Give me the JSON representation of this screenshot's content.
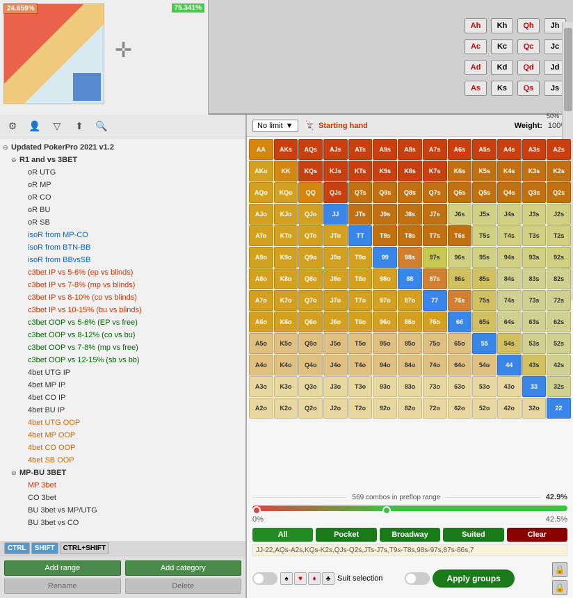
{
  "top": {
    "pct_red": "24.659%",
    "pct_green": "75.341%",
    "plus_icon": "✛",
    "cards": [
      [
        "Ah",
        "Kh",
        "Qh",
        "Jh"
      ],
      [
        "Ac",
        "Kc",
        "Qc",
        "Jc"
      ],
      [
        "Ad",
        "Kd",
        "Qd",
        "Jd"
      ],
      [
        "As",
        "Ks",
        "Qs",
        "Js"
      ]
    ],
    "card_colors": [
      [
        "red",
        "black",
        "red",
        "black"
      ],
      [
        "red",
        "black",
        "red",
        "black"
      ],
      [
        "red",
        "black",
        "red",
        "black"
      ],
      [
        "red",
        "black",
        "red",
        "black"
      ]
    ]
  },
  "toolbar": {
    "gear": "⚙",
    "person": "👤",
    "filter": "▽",
    "upload": "⬆",
    "search": "🔍"
  },
  "tree": {
    "root_label": "Updated PokerPro 2021 v1.2",
    "items": [
      {
        "id": "r1",
        "label": "R1 and vs 3BET",
        "indent": 1,
        "type": "parent",
        "color": "normal"
      },
      {
        "id": "utg",
        "label": "oR UTG",
        "indent": 2,
        "type": "leaf",
        "color": "normal"
      },
      {
        "id": "mp",
        "label": "oR MP",
        "indent": 2,
        "type": "leaf",
        "color": "normal"
      },
      {
        "id": "co",
        "label": "oR CO",
        "indent": 2,
        "type": "leaf",
        "color": "normal"
      },
      {
        "id": "bu",
        "label": "oR BU",
        "indent": 2,
        "type": "leaf",
        "color": "normal"
      },
      {
        "id": "sb",
        "label": "oR SB",
        "indent": 2,
        "type": "leaf",
        "color": "normal"
      },
      {
        "id": "isor_mp",
        "label": "isoR from MP-CO",
        "indent": 2,
        "type": "leaf",
        "color": "blue"
      },
      {
        "id": "isor_btn",
        "label": "isoR from BTN-BB",
        "indent": 2,
        "type": "leaf",
        "color": "blue"
      },
      {
        "id": "isor_bb",
        "label": "isoR from BBvsSB",
        "indent": 2,
        "type": "leaf",
        "color": "blue"
      },
      {
        "id": "c3bet56",
        "label": "c3bet IP vs 5-6% (ep vs blinds)",
        "indent": 2,
        "type": "leaf",
        "color": "red"
      },
      {
        "id": "c3bet78",
        "label": "c3bet IP vs 7-8% (mp vs blinds)",
        "indent": 2,
        "type": "leaf",
        "color": "red"
      },
      {
        "id": "c3bet810",
        "label": "c3bet IP vs 8-10% (co vs blinds)",
        "indent": 2,
        "type": "leaf",
        "color": "red"
      },
      {
        "id": "c3bet1015",
        "label": "c3bet IP vs 10-15% (bu vs blinds)",
        "indent": 2,
        "type": "leaf",
        "color": "red"
      },
      {
        "id": "c3bet_oop56",
        "label": "c3bet OOP vs 5-6% (EP vs free)",
        "indent": 2,
        "type": "leaf",
        "color": "green"
      },
      {
        "id": "c3bet_oop812",
        "label": "c3bet OOP vs 8-12% (co vs bu)",
        "indent": 2,
        "type": "leaf",
        "color": "green"
      },
      {
        "id": "c3bet_oop78",
        "label": "c3bet OOP vs 7-8% (mp vs free)",
        "indent": 2,
        "type": "leaf",
        "color": "green"
      },
      {
        "id": "c3bet_oop1215",
        "label": "c3bet OOP vs 12-15% (sb vs bb)",
        "indent": 2,
        "type": "leaf",
        "color": "green"
      },
      {
        "id": "4bet_utg",
        "label": "4bet UTG IP",
        "indent": 2,
        "type": "leaf",
        "color": "normal"
      },
      {
        "id": "4bet_mp",
        "label": "4bet MP IP",
        "indent": 2,
        "type": "leaf",
        "color": "normal"
      },
      {
        "id": "4bet_co",
        "label": "4bet CO IP",
        "indent": 2,
        "type": "leaf",
        "color": "normal"
      },
      {
        "id": "4bet_bu",
        "label": "4bet BU IP",
        "indent": 2,
        "type": "leaf",
        "color": "normal"
      },
      {
        "id": "4bet_utg_oop",
        "label": "4bet UTG OOP",
        "indent": 2,
        "type": "leaf",
        "color": "orange"
      },
      {
        "id": "4bet_mp_oop",
        "label": "4bet MP OOP",
        "indent": 2,
        "type": "leaf",
        "color": "orange"
      },
      {
        "id": "4bet_co_oop",
        "label": "4bet CO OOP",
        "indent": 2,
        "type": "leaf",
        "color": "orange"
      },
      {
        "id": "4bet_sb_oop",
        "label": "4bet SB OOP",
        "indent": 2,
        "type": "leaf",
        "color": "orange"
      },
      {
        "id": "mpbu",
        "label": "MP-BU 3BET",
        "indent": 1,
        "type": "parent",
        "color": "bold"
      },
      {
        "id": "mp3",
        "label": "MP 3bet",
        "indent": 2,
        "type": "leaf",
        "color": "red"
      },
      {
        "id": "co3",
        "label": "CO 3bet",
        "indent": 2,
        "type": "leaf",
        "color": "normal"
      },
      {
        "id": "bu3mp",
        "label": "BU 3bet vs MP/UTG",
        "indent": 2,
        "type": "leaf",
        "color": "normal"
      },
      {
        "id": "bu3co",
        "label": "BU 3bet vs CO",
        "indent": 2,
        "type": "leaf",
        "color": "normal"
      }
    ]
  },
  "range_header": {
    "dropdown_label": "No limit",
    "starting_hand_label": "Starting hand",
    "weight_label": "Weight:",
    "weight_value": "100%"
  },
  "hand_grid": {
    "cells": [
      [
        "AA",
        "AKs",
        "AQs",
        "AJs",
        "ATs",
        "A9s",
        "A8s",
        "A7s",
        "A6s",
        "A5s",
        "A4s",
        "A3s",
        "A2s"
      ],
      [
        "AKo",
        "KK",
        "KQs",
        "KJs",
        "KTs",
        "K9s",
        "K8s",
        "K7s",
        "K6s",
        "K5s",
        "K4s",
        "K3s",
        "K2s"
      ],
      [
        "AQo",
        "KQo",
        "QQ",
        "QJs",
        "QTs",
        "Q9s",
        "Q8s",
        "Q7s",
        "Q6s",
        "Q5s",
        "Q4s",
        "Q3s",
        "Q2s"
      ],
      [
        "AJo",
        "KJo",
        "QJo",
        "JJ",
        "JTs",
        "J9s",
        "J8s",
        "J7s",
        "J6s",
        "J5s",
        "J4s",
        "J3s",
        "J2s"
      ],
      [
        "ATo",
        "KTo",
        "QTo",
        "JTo",
        "TT",
        "T9s",
        "T8s",
        "T7s",
        "T6s",
        "T5s",
        "T4s",
        "T3s",
        "T2s"
      ],
      [
        "A9o",
        "K9o",
        "Q9o",
        "J9o",
        "T9o",
        "99",
        "98s",
        "97s",
        "96s",
        "95s",
        "94s",
        "93s",
        "92s"
      ],
      [
        "A8o",
        "K8o",
        "Q8o",
        "J8o",
        "T8o",
        "98o",
        "88",
        "87s",
        "86s",
        "85s",
        "84s",
        "83s",
        "82s"
      ],
      [
        "A7o",
        "K7o",
        "Q7o",
        "J7o",
        "T7o",
        "97o",
        "87o",
        "77",
        "76s",
        "75s",
        "74s",
        "73s",
        "72s"
      ],
      [
        "A6o",
        "K6o",
        "Q6o",
        "J6o",
        "T6o",
        "96o",
        "86o",
        "76o",
        "66",
        "65s",
        "64s",
        "63s",
        "62s"
      ],
      [
        "A5o",
        "K5o",
        "Q5o",
        "J5o",
        "T5o",
        "95o",
        "85o",
        "75o",
        "65o",
        "55",
        "54s",
        "53s",
        "52s"
      ],
      [
        "A4o",
        "K4o",
        "Q4o",
        "J4o",
        "T4o",
        "94o",
        "84o",
        "74o",
        "64o",
        "54o",
        "44",
        "43s",
        "42s"
      ],
      [
        "A3o",
        "K3o",
        "Q3o",
        "J3o",
        "T3o",
        "93o",
        "83o",
        "73o",
        "63o",
        "53o",
        "43o",
        "33",
        "32s"
      ],
      [
        "A2o",
        "K2o",
        "Q2o",
        "J2o",
        "T2o",
        "92o",
        "82o",
        "72o",
        "62o",
        "52o",
        "42o",
        "32o",
        "22"
      ]
    ],
    "colors": [
      [
        "pair",
        "suited",
        "suited",
        "suited",
        "suited",
        "suited",
        "suited",
        "suited",
        "suited",
        "suited",
        "suited",
        "suited",
        "suited"
      ],
      [
        "offsuit",
        "pair",
        "suited",
        "suited",
        "suited",
        "suited",
        "suited",
        "suited",
        "suited",
        "suited",
        "suited",
        "suited",
        "suited"
      ],
      [
        "offsuit",
        "offsuit",
        "pair",
        "suited",
        "suited",
        "suited",
        "suited",
        "suited",
        "suited",
        "suited",
        "suited",
        "suited",
        "suited"
      ],
      [
        "offsuit",
        "offsuit",
        "offsuit",
        "pair",
        "suited",
        "suited",
        "suited",
        "suited",
        "suited",
        "suited",
        "suited",
        "suited",
        "suited"
      ],
      [
        "offsuit",
        "offsuit",
        "offsuit",
        "offsuit",
        "pair",
        "suited",
        "suited",
        "suited",
        "suited",
        "suited",
        "suited",
        "suited",
        "suited"
      ],
      [
        "offsuit",
        "offsuit",
        "offsuit",
        "offsuit",
        "offsuit",
        "pair",
        "suited",
        "suited",
        "suited",
        "suited",
        "suited",
        "suited",
        "suited"
      ],
      [
        "offsuit",
        "offsuit",
        "offsuit",
        "offsuit",
        "offsuit",
        "offsuit",
        "pair",
        "suited",
        "suited",
        "suited",
        "suited",
        "suited",
        "suited"
      ],
      [
        "offsuit",
        "offsuit",
        "offsuit",
        "offsuit",
        "offsuit",
        "offsuit",
        "offsuit",
        "pair",
        "suited",
        "suited",
        "suited",
        "suited",
        "suited"
      ],
      [
        "offsuit",
        "offsuit",
        "offsuit",
        "offsuit",
        "offsuit",
        "offsuit",
        "offsuit",
        "offsuit",
        "pair",
        "suited",
        "suited",
        "suited",
        "suited"
      ],
      [
        "offsuit",
        "offsuit",
        "offsuit",
        "offsuit",
        "offsuit",
        "offsuit",
        "offsuit",
        "offsuit",
        "offsuit",
        "pair",
        "suited",
        "suited",
        "suited"
      ],
      [
        "offsuit",
        "offsuit",
        "offsuit",
        "offsuit",
        "offsuit",
        "offsuit",
        "offsuit",
        "offsuit",
        "offsuit",
        "offsuit",
        "pair",
        "suited",
        "suited"
      ],
      [
        "offsuit",
        "offsuit",
        "offsuit",
        "offsuit",
        "offsuit",
        "offsuit",
        "offsuit",
        "offsuit",
        "offsuit",
        "offsuit",
        "offsuit",
        "pair",
        "suited"
      ],
      [
        "offsuit",
        "offsuit",
        "offsuit",
        "offsuit",
        "offsuit",
        "offsuit",
        "offsuit",
        "offsuit",
        "offsuit",
        "offsuit",
        "offsuit",
        "offsuit",
        "pair"
      ]
    ],
    "highlight_map": {
      "0,0": "blue",
      "0,1": "yellow",
      "0,2": "yellow",
      "0,3": "yellow",
      "0,4": "yellow",
      "0,5": "yellow",
      "0,6": "yellow",
      "0,7": "yellow",
      "0,8": "yellow",
      "0,9": "yellow",
      "0,10": "yellow",
      "0,11": "yellow",
      "0,12": "yellow",
      "1,0": "orange",
      "1,1": "blue",
      "1,2": "yellow",
      "1,3": "yellow",
      "1,4": "yellow",
      "1,5": "yellow",
      "1,6": "yellow",
      "1,7": "yellow",
      "2,0": "orange",
      "2,1": "orange",
      "2,2": "blue",
      "2,3": "yellow",
      "2,4": "yellow",
      "3,0": "orange",
      "3,1": "orange",
      "3,2": "orange",
      "3,3": "blue",
      "3,4": "yellow",
      "4,0": "orange",
      "4,1": "orange",
      "4,2": "orange",
      "4,3": "orange",
      "4,4": "blue",
      "5,5": "blue",
      "6,6": "blue",
      "6,7": "yellow",
      "6,8": "yellow",
      "6,9": "yellow",
      "7,7": "blue",
      "7,8": "yellow",
      "7,9": "yellow",
      "7,10": "yellow",
      "8,8": "blue",
      "8,9": "yellow",
      "9,9": "blue",
      "9,10": "yellow",
      "9,11": "yellow",
      "10,10": "blue",
      "10,11": "yellow",
      "11,11": "blue",
      "12,12": "blue"
    }
  },
  "range_info": {
    "combos": "569 combos in preflop range",
    "pct": "42.9%",
    "slider_min": "0%",
    "slider_max": "",
    "slider_current": "42.5%",
    "combos_text": "JJ-22,AQs-A2s,KQs-K2s,QJs-Q2s,JTs-J7s,T9s-T8s,98s-97s,87s-86s,7"
  },
  "filter_buttons": {
    "all": "All",
    "pocket": "Pocket",
    "broadway": "Broadway",
    "suited": "Suited",
    "clear": "Clear"
  },
  "toggles": {
    "suit_selection_label": "Suit selection",
    "apply_groups_label": "Apply groups",
    "suit_icons": [
      "♠",
      "♥",
      "♦",
      "♣"
    ]
  },
  "bottom_buttons": {
    "add_range": "Add range",
    "add_category": "Add category",
    "rename": "Rename",
    "delete": "Delete"
  },
  "keyboard": {
    "ctrl": "CTRL",
    "shift": "SHIFT",
    "ctrl_shift": "CTRL+SHIFT"
  }
}
